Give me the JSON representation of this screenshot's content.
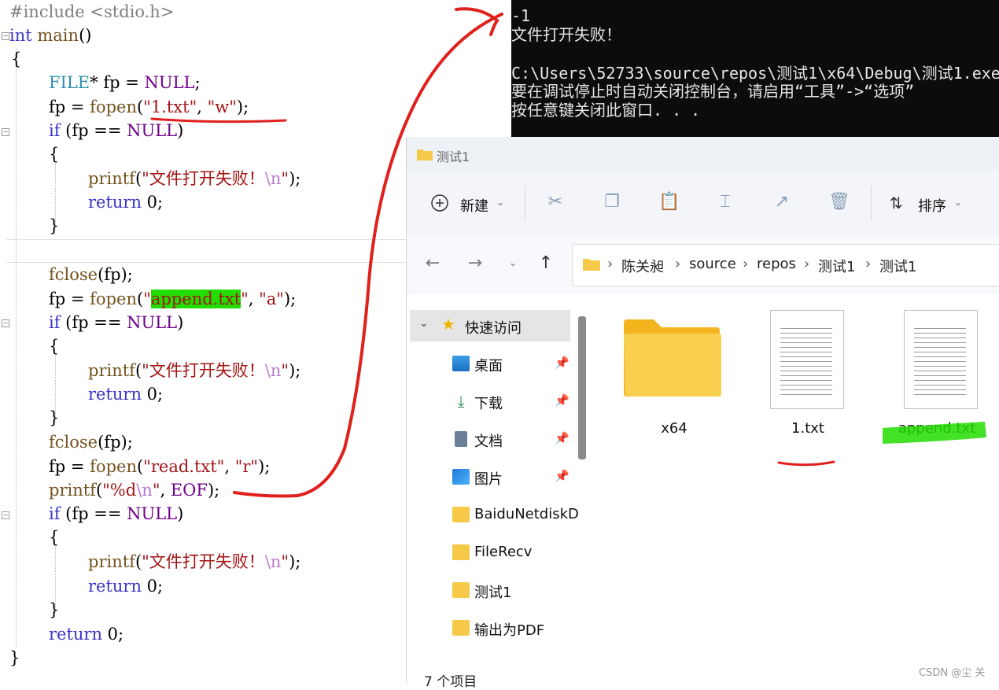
{
  "editor": {
    "lines": [
      "#include <stdio.h>",
      "int main()",
      "{",
      "FILE* fp = NULL;",
      "fp = fopen(\"1.txt\", \"w\");",
      "if (fp == NULL)",
      "{",
      "printf(\"文件打开失败！\\n\");",
      "return 0;",
      "}",
      "",
      "fclose(fp);",
      "fp = fopen(\"append.txt\", \"a\");",
      "if (fp == NULL)",
      "{",
      "printf(\"文件打开失败！\\n\");",
      "return 0;",
      "}",
      "fclose(fp);",
      "fp = fopen(\"read.txt\", \"r\");",
      "printf(\"%d\\n\", EOF);",
      "if (fp == NULL)",
      "{",
      "printf(\"文件打开失败！\\n\");",
      "return 0;",
      "}",
      "return 0;",
      "}"
    ]
  },
  "console": {
    "lines": [
      "-1",
      "文件打开失败！",
      "",
      "C:\\Users\\52733\\source\\repos\\测试1\\x64\\Debug\\测试1.exe",
      "要在调试停止时自动关闭控制台，请启用“工具”->“选项”",
      "按任意键关闭此窗口. . ."
    ]
  },
  "explorer": {
    "title": "测试1",
    "toolbar": {
      "new_label": "新建",
      "sort_label": "排序"
    },
    "breadcrumb": [
      "陈关昶",
      "source",
      "repos",
      "测试1",
      "测试1"
    ],
    "sidebar": {
      "quick_access": "快速访问",
      "items": [
        {
          "label": "桌面",
          "icon": "desktop-icon",
          "pinned": true
        },
        {
          "label": "下载",
          "icon": "download-icon",
          "pinned": true
        },
        {
          "label": "文档",
          "icon": "document-icon",
          "pinned": true
        },
        {
          "label": "图片",
          "icon": "picture-icon",
          "pinned": true
        },
        {
          "label": "BaiduNetdiskD",
          "icon": "folder-icon",
          "pinned": false
        },
        {
          "label": "FileRecv",
          "icon": "folder-icon",
          "pinned": false
        },
        {
          "label": "测试1",
          "icon": "folder-icon",
          "pinned": false
        },
        {
          "label": "输出为PDF",
          "icon": "folder-icon",
          "pinned": false
        }
      ]
    },
    "files": [
      {
        "name": "x64",
        "icon": "folder-icon"
      },
      {
        "name": "1.txt",
        "icon": "text-file-icon"
      },
      {
        "name": "append.txt",
        "icon": "text-file-icon"
      }
    ],
    "status": "7 个项目",
    "colors": {
      "folder": "#f7c948",
      "accent": "#0067c0"
    }
  },
  "annotations": {
    "ink_color": "#e0201c",
    "highlight_color": "#22dd00"
  },
  "watermark": "CSDN @尘 关"
}
